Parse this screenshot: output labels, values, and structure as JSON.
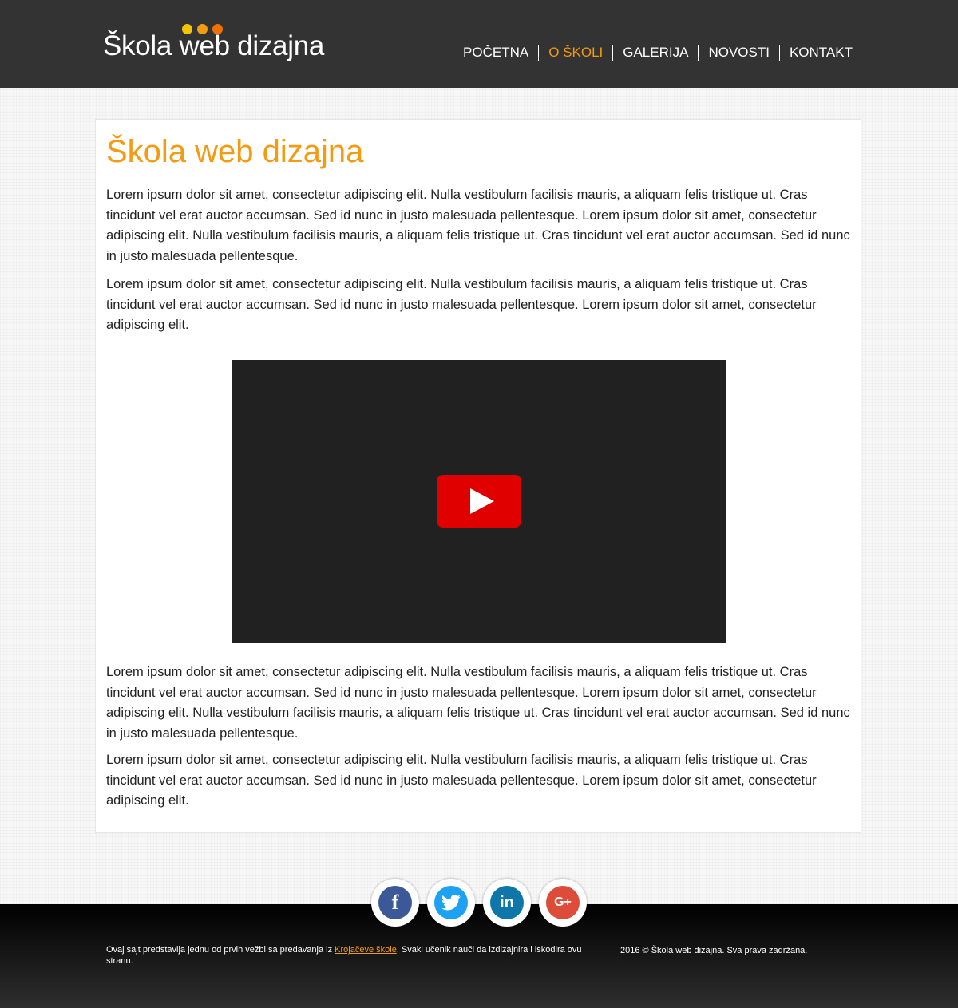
{
  "brand": {
    "name": "Škola web dizajna",
    "dot_colors": [
      "#f5c400",
      "#f39c12",
      "#f07000"
    ]
  },
  "nav": {
    "items": [
      {
        "label": "POČETNA",
        "active": false
      },
      {
        "label": "O ŠKOLI",
        "active": true
      },
      {
        "label": "GALERIJA",
        "active": false
      },
      {
        "label": "NOVOSTI",
        "active": false
      },
      {
        "label": "KONTAKT",
        "active": false
      }
    ]
  },
  "main": {
    "title": "Škola web dizajna",
    "paragraphs": [
      "Lorem ipsum dolor sit amet, consectetur adipiscing elit. Nulla vestibulum facilisis mauris, a aliquam felis tristique ut. Cras tincidunt vel erat auctor accumsan. Sed id nunc in justo malesuada pellentesque. Lorem ipsum dolor sit amet, consectetur adipiscing elit. Nulla vestibulum facilisis mauris, a aliquam felis tristique ut. Cras tincidunt vel erat auctor accumsan. Sed id nunc in justo malesuada pellentesque.",
      "Lorem ipsum dolor sit amet, consectetur adipiscing elit. Nulla vestibulum facilisis mauris, a aliquam felis tristique ut. Cras tincidunt vel erat auctor accumsan. Sed id nunc in justo malesuada pellentesque. Lorem ipsum dolor sit amet, consectetur adipiscing elit.",
      "Lorem ipsum dolor sit amet, consectetur adipiscing elit. Nulla vestibulum facilisis mauris, a aliquam felis tristique ut. Cras tincidunt vel erat auctor accumsan. Sed id nunc in justo malesuada pellentesque. Lorem ipsum dolor sit amet, consectetur adipiscing elit. Nulla vestibulum facilisis mauris, a aliquam felis tristique ut. Cras tincidunt vel erat auctor accumsan. Sed id nunc in justo malesuada pellentesque.",
      "Lorem ipsum dolor sit amet, consectetur adipiscing elit. Nulla vestibulum facilisis mauris, a aliquam felis tristique ut. Cras tincidunt vel erat auctor accumsan. Sed id nunc in justo malesuada pellentesque. Lorem ipsum dolor sit amet, consectetur adipiscing elit."
    ],
    "video": {
      "icon": "play-icon",
      "button_color": "#e00000"
    }
  },
  "social": [
    {
      "name": "facebook-icon",
      "glyph": "f",
      "color": "#3b5998"
    },
    {
      "name": "twitter-icon",
      "glyph": "🐦",
      "color": "#1da1f2"
    },
    {
      "name": "linkedin-icon",
      "glyph": "in",
      "color": "#0e76a8"
    },
    {
      "name": "google-plus-icon",
      "glyph": "G+",
      "color": "#dd4b39"
    }
  ],
  "footer": {
    "text_before": "Ovaj sajt predstavlja jednu od prvih vežbi sa predavanja iz ",
    "link_text": "Krojačeve škole",
    "text_after": ". Svaki učenik nauči da izdizajnira i iskodira ovu stranu.",
    "copyright": "2016 © Škola web dizajna. Sva prava zadržana."
  },
  "colors": {
    "accent": "#f39c12",
    "header_bg": "#333333"
  }
}
